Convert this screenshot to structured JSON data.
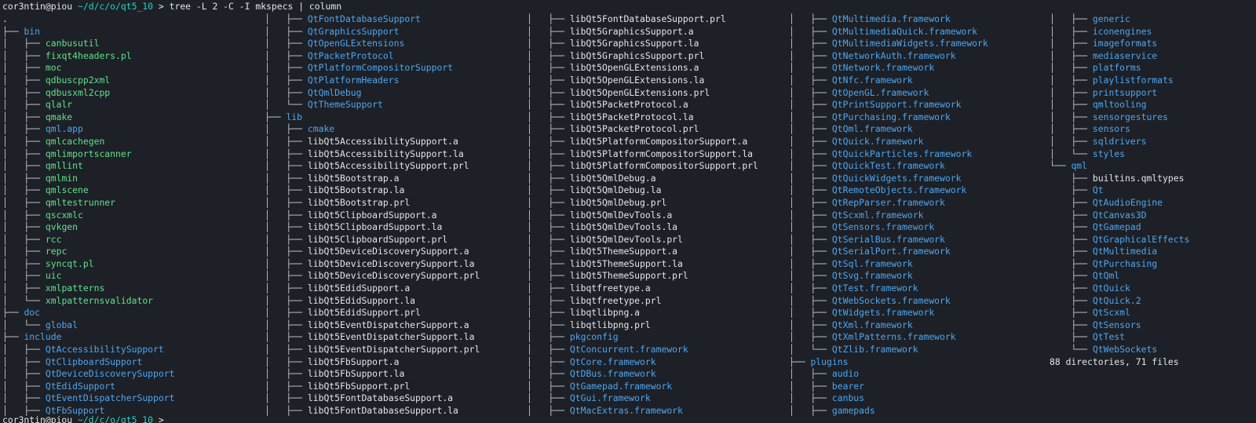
{
  "terminal": {
    "prompt": {
      "user_host": "cor3ntin@piou",
      "path": "~/d/c/o/qt5_10",
      "symbol": ">",
      "command": "tree -L 2 -C -I mkspecs | column"
    },
    "last_prompt": {
      "user_host": "cor3ntin@piou",
      "path": "~/d/c/o/qt5_10",
      "symbol": ">"
    },
    "colors": {
      "background": "#1d2026",
      "text": "#e3e6ea",
      "directory": "#4ea6f0",
      "executable": "#5fe28b",
      "prompt_path": "#23d3c6"
    },
    "columns": [
      [
        {
          "p": "",
          "n": ".",
          "k": "file"
        },
        {
          "p": "├── ",
          "n": "bin",
          "k": "dir"
        },
        {
          "p": "│   ├── ",
          "n": "canbusutil",
          "k": "exec"
        },
        {
          "p": "│   ├── ",
          "n": "fixqt4headers.pl",
          "k": "exec"
        },
        {
          "p": "│   ├── ",
          "n": "moc",
          "k": "exec"
        },
        {
          "p": "│   ├── ",
          "n": "qdbuscpp2xml",
          "k": "exec"
        },
        {
          "p": "│   ├── ",
          "n": "qdbusxml2cpp",
          "k": "exec"
        },
        {
          "p": "│   ├── ",
          "n": "qlalr",
          "k": "exec"
        },
        {
          "p": "│   ├── ",
          "n": "qmake",
          "k": "exec"
        },
        {
          "p": "│   ├── ",
          "n": "qml.app",
          "k": "dir"
        },
        {
          "p": "│   ├── ",
          "n": "qmlcachegen",
          "k": "exec"
        },
        {
          "p": "│   ├── ",
          "n": "qmlimportscanner",
          "k": "exec"
        },
        {
          "p": "│   ├── ",
          "n": "qmllint",
          "k": "exec"
        },
        {
          "p": "│   ├── ",
          "n": "qmlmin",
          "k": "exec"
        },
        {
          "p": "│   ├── ",
          "n": "qmlscene",
          "k": "exec"
        },
        {
          "p": "│   ├── ",
          "n": "qmltestrunner",
          "k": "exec"
        },
        {
          "p": "│   ├── ",
          "n": "qscxmlc",
          "k": "exec"
        },
        {
          "p": "│   ├── ",
          "n": "qvkgen",
          "k": "exec"
        },
        {
          "p": "│   ├── ",
          "n": "rcc",
          "k": "exec"
        },
        {
          "p": "│   ├── ",
          "n": "repc",
          "k": "exec"
        },
        {
          "p": "│   ├── ",
          "n": "syncqt.pl",
          "k": "exec"
        },
        {
          "p": "│   ├── ",
          "n": "uic",
          "k": "exec"
        },
        {
          "p": "│   ├── ",
          "n": "xmlpatterns",
          "k": "exec"
        },
        {
          "p": "│   └── ",
          "n": "xmlpatternsvalidator",
          "k": "exec"
        },
        {
          "p": "├── ",
          "n": "doc",
          "k": "dir"
        },
        {
          "p": "│   └── ",
          "n": "global",
          "k": "dir"
        },
        {
          "p": "├── ",
          "n": "include",
          "k": "dir"
        },
        {
          "p": "│   ├── ",
          "n": "QtAccessibilitySupport",
          "k": "dir"
        },
        {
          "p": "│   ├── ",
          "n": "QtClipboardSupport",
          "k": "dir"
        },
        {
          "p": "│   ├── ",
          "n": "QtDeviceDiscoverySupport",
          "k": "dir"
        },
        {
          "p": "│   ├── ",
          "n": "QtEdidSupport",
          "k": "dir"
        },
        {
          "p": "│   ├── ",
          "n": "QtEventDispatcherSupport",
          "k": "dir"
        },
        {
          "p": "│   ├── ",
          "n": "QtFbSupport",
          "k": "dir"
        }
      ],
      [
        {
          "p": "│   ├── ",
          "n": "QtFontDatabaseSupport",
          "k": "dir"
        },
        {
          "p": "│   ├── ",
          "n": "QtGraphicsSupport",
          "k": "dir"
        },
        {
          "p": "│   ├── ",
          "n": "QtOpenGLExtensions",
          "k": "dir"
        },
        {
          "p": "│   ├── ",
          "n": "QtPacketProtocol",
          "k": "dir"
        },
        {
          "p": "│   ├── ",
          "n": "QtPlatformCompositorSupport",
          "k": "dir"
        },
        {
          "p": "│   ├── ",
          "n": "QtPlatformHeaders",
          "k": "dir"
        },
        {
          "p": "│   ├── ",
          "n": "QtQmlDebug",
          "k": "dir"
        },
        {
          "p": "│   └── ",
          "n": "QtThemeSupport",
          "k": "dir"
        },
        {
          "p": "├── ",
          "n": "lib",
          "k": "dir"
        },
        {
          "p": "│   ├── ",
          "n": "cmake",
          "k": "dir"
        },
        {
          "p": "│   ├── ",
          "n": "libQt5AccessibilitySupport.a",
          "k": "file"
        },
        {
          "p": "│   ├── ",
          "n": "libQt5AccessibilitySupport.la",
          "k": "file"
        },
        {
          "p": "│   ├── ",
          "n": "libQt5AccessibilitySupport.prl",
          "k": "file"
        },
        {
          "p": "│   ├── ",
          "n": "libQt5Bootstrap.a",
          "k": "file"
        },
        {
          "p": "│   ├── ",
          "n": "libQt5Bootstrap.la",
          "k": "file"
        },
        {
          "p": "│   ├── ",
          "n": "libQt5Bootstrap.prl",
          "k": "file"
        },
        {
          "p": "│   ├── ",
          "n": "libQt5ClipboardSupport.a",
          "k": "file"
        },
        {
          "p": "│   ├── ",
          "n": "libQt5ClipboardSupport.la",
          "k": "file"
        },
        {
          "p": "│   ├── ",
          "n": "libQt5ClipboardSupport.prl",
          "k": "file"
        },
        {
          "p": "│   ├── ",
          "n": "libQt5DeviceDiscoverySupport.a",
          "k": "file"
        },
        {
          "p": "│   ├── ",
          "n": "libQt5DeviceDiscoverySupport.la",
          "k": "file"
        },
        {
          "p": "│   ├── ",
          "n": "libQt5DeviceDiscoverySupport.prl",
          "k": "file"
        },
        {
          "p": "│   ├── ",
          "n": "libQt5EdidSupport.a",
          "k": "file"
        },
        {
          "p": "│   ├── ",
          "n": "libQt5EdidSupport.la",
          "k": "file"
        },
        {
          "p": "│   ├── ",
          "n": "libQt5EdidSupport.prl",
          "k": "file"
        },
        {
          "p": "│   ├── ",
          "n": "libQt5EventDispatcherSupport.a",
          "k": "file"
        },
        {
          "p": "│   ├── ",
          "n": "libQt5EventDispatcherSupport.la",
          "k": "file"
        },
        {
          "p": "│   ├── ",
          "n": "libQt5EventDispatcherSupport.prl",
          "k": "file"
        },
        {
          "p": "│   ├── ",
          "n": "libQt5FbSupport.a",
          "k": "file"
        },
        {
          "p": "│   ├── ",
          "n": "libQt5FbSupport.la",
          "k": "file"
        },
        {
          "p": "│   ├── ",
          "n": "libQt5FbSupport.prl",
          "k": "file"
        },
        {
          "p": "│   ├── ",
          "n": "libQt5FontDatabaseSupport.a",
          "k": "file"
        },
        {
          "p": "│   ├── ",
          "n": "libQt5FontDatabaseSupport.la",
          "k": "file"
        }
      ],
      [
        {
          "p": "│   ├── ",
          "n": "libQt5FontDatabaseSupport.prl",
          "k": "file"
        },
        {
          "p": "│   ├── ",
          "n": "libQt5GraphicsSupport.a",
          "k": "file"
        },
        {
          "p": "│   ├── ",
          "n": "libQt5GraphicsSupport.la",
          "k": "file"
        },
        {
          "p": "│   ├── ",
          "n": "libQt5GraphicsSupport.prl",
          "k": "file"
        },
        {
          "p": "│   ├── ",
          "n": "libQt5OpenGLExtensions.a",
          "k": "file"
        },
        {
          "p": "│   ├── ",
          "n": "libQt5OpenGLExtensions.la",
          "k": "file"
        },
        {
          "p": "│   ├── ",
          "n": "libQt5OpenGLExtensions.prl",
          "k": "file"
        },
        {
          "p": "│   ├── ",
          "n": "libQt5PacketProtocol.a",
          "k": "file"
        },
        {
          "p": "│   ├── ",
          "n": "libQt5PacketProtocol.la",
          "k": "file"
        },
        {
          "p": "│   ├── ",
          "n": "libQt5PacketProtocol.prl",
          "k": "file"
        },
        {
          "p": "│   ├── ",
          "n": "libQt5PlatformCompositorSupport.a",
          "k": "file"
        },
        {
          "p": "│   ├── ",
          "n": "libQt5PlatformCompositorSupport.la",
          "k": "file"
        },
        {
          "p": "│   ├── ",
          "n": "libQt5PlatformCompositorSupport.prl",
          "k": "file"
        },
        {
          "p": "│   ├── ",
          "n": "libQt5QmlDebug.a",
          "k": "file"
        },
        {
          "p": "│   ├── ",
          "n": "libQt5QmlDebug.la",
          "k": "file"
        },
        {
          "p": "│   ├── ",
          "n": "libQt5QmlDebug.prl",
          "k": "file"
        },
        {
          "p": "│   ├── ",
          "n": "libQt5QmlDevTools.a",
          "k": "file"
        },
        {
          "p": "│   ├── ",
          "n": "libQt5QmlDevTools.la",
          "k": "file"
        },
        {
          "p": "│   ├── ",
          "n": "libQt5QmlDevTools.prl",
          "k": "file"
        },
        {
          "p": "│   ├── ",
          "n": "libQt5ThemeSupport.a",
          "k": "file"
        },
        {
          "p": "│   ├── ",
          "n": "libQt5ThemeSupport.la",
          "k": "file"
        },
        {
          "p": "│   ├── ",
          "n": "libQt5ThemeSupport.prl",
          "k": "file"
        },
        {
          "p": "│   ├── ",
          "n": "libqtfreetype.a",
          "k": "file"
        },
        {
          "p": "│   ├── ",
          "n": "libqtfreetype.prl",
          "k": "file"
        },
        {
          "p": "│   ├── ",
          "n": "libqtlibpng.a",
          "k": "file"
        },
        {
          "p": "│   ├── ",
          "n": "libqtlibpng.prl",
          "k": "file"
        },
        {
          "p": "│   ├── ",
          "n": "pkgconfig",
          "k": "dir"
        },
        {
          "p": "│   ├── ",
          "n": "QtConcurrent.framework",
          "k": "dir"
        },
        {
          "p": "│   ├── ",
          "n": "QtCore.framework",
          "k": "dir"
        },
        {
          "p": "│   ├── ",
          "n": "QtDBus.framework",
          "k": "dir"
        },
        {
          "p": "│   ├── ",
          "n": "QtGamepad.framework",
          "k": "dir"
        },
        {
          "p": "│   ├── ",
          "n": "QtGui.framework",
          "k": "dir"
        },
        {
          "p": "│   ├── ",
          "n": "QtMacExtras.framework",
          "k": "dir"
        }
      ],
      [
        {
          "p": "│   ├── ",
          "n": "QtMultimedia.framework",
          "k": "dir"
        },
        {
          "p": "│   ├── ",
          "n": "QtMultimediaQuick.framework",
          "k": "dir"
        },
        {
          "p": "│   ├── ",
          "n": "QtMultimediaWidgets.framework",
          "k": "dir"
        },
        {
          "p": "│   ├── ",
          "n": "QtNetworkAuth.framework",
          "k": "dir"
        },
        {
          "p": "│   ├── ",
          "n": "QtNetwork.framework",
          "k": "dir"
        },
        {
          "p": "│   ├── ",
          "n": "QtNfc.framework",
          "k": "dir"
        },
        {
          "p": "│   ├── ",
          "n": "QtOpenGL.framework",
          "k": "dir"
        },
        {
          "p": "│   ├── ",
          "n": "QtPrintSupport.framework",
          "k": "dir"
        },
        {
          "p": "│   ├── ",
          "n": "QtPurchasing.framework",
          "k": "dir"
        },
        {
          "p": "│   ├── ",
          "n": "QtQml.framework",
          "k": "dir"
        },
        {
          "p": "│   ├── ",
          "n": "QtQuick.framework",
          "k": "dir"
        },
        {
          "p": "│   ├── ",
          "n": "QtQuickParticles.framework",
          "k": "dir"
        },
        {
          "p": "│   ├── ",
          "n": "QtQuickTest.framework",
          "k": "dir"
        },
        {
          "p": "│   ├── ",
          "n": "QtQuickWidgets.framework",
          "k": "dir"
        },
        {
          "p": "│   ├── ",
          "n": "QtRemoteObjects.framework",
          "k": "dir"
        },
        {
          "p": "│   ├── ",
          "n": "QtRepParser.framework",
          "k": "dir"
        },
        {
          "p": "│   ├── ",
          "n": "QtScxml.framework",
          "k": "dir"
        },
        {
          "p": "│   ├── ",
          "n": "QtSensors.framework",
          "k": "dir"
        },
        {
          "p": "│   ├── ",
          "n": "QtSerialBus.framework",
          "k": "dir"
        },
        {
          "p": "│   ├── ",
          "n": "QtSerialPort.framework",
          "k": "dir"
        },
        {
          "p": "│   ├── ",
          "n": "QtSql.framework",
          "k": "dir"
        },
        {
          "p": "│   ├── ",
          "n": "QtSvg.framework",
          "k": "dir"
        },
        {
          "p": "│   ├── ",
          "n": "QtTest.framework",
          "k": "dir"
        },
        {
          "p": "│   ├── ",
          "n": "QtWebSockets.framework",
          "k": "dir"
        },
        {
          "p": "│   ├── ",
          "n": "QtWidgets.framework",
          "k": "dir"
        },
        {
          "p": "│   ├── ",
          "n": "QtXml.framework",
          "k": "dir"
        },
        {
          "p": "│   ├── ",
          "n": "QtXmlPatterns.framework",
          "k": "dir"
        },
        {
          "p": "│   └── ",
          "n": "QtZlib.framework",
          "k": "dir"
        },
        {
          "p": "├── ",
          "n": "plugins",
          "k": "dir"
        },
        {
          "p": "│   ├── ",
          "n": "audio",
          "k": "dir"
        },
        {
          "p": "│   ├── ",
          "n": "bearer",
          "k": "dir"
        },
        {
          "p": "│   ├── ",
          "n": "canbus",
          "k": "dir"
        },
        {
          "p": "│   ├── ",
          "n": "gamepads",
          "k": "dir"
        }
      ],
      [
        {
          "p": "│   ├── ",
          "n": "generic",
          "k": "dir"
        },
        {
          "p": "│   ├── ",
          "n": "iconengines",
          "k": "dir"
        },
        {
          "p": "│   ├── ",
          "n": "imageformats",
          "k": "dir"
        },
        {
          "p": "│   ├── ",
          "n": "mediaservice",
          "k": "dir"
        },
        {
          "p": "│   ├── ",
          "n": "platforms",
          "k": "dir"
        },
        {
          "p": "│   ├── ",
          "n": "playlistformats",
          "k": "dir"
        },
        {
          "p": "│   ├── ",
          "n": "printsupport",
          "k": "dir"
        },
        {
          "p": "│   ├── ",
          "n": "qmltooling",
          "k": "dir"
        },
        {
          "p": "│   ├── ",
          "n": "sensorgestures",
          "k": "dir"
        },
        {
          "p": "│   ├── ",
          "n": "sensors",
          "k": "dir"
        },
        {
          "p": "│   ├── ",
          "n": "sqldrivers",
          "k": "dir"
        },
        {
          "p": "│   └── ",
          "n": "styles",
          "k": "dir"
        },
        {
          "p": "└── ",
          "n": "qml",
          "k": "dir"
        },
        {
          "p": "    ├── ",
          "n": "builtins.qmltypes",
          "k": "file"
        },
        {
          "p": "    ├── ",
          "n": "Qt",
          "k": "dir"
        },
        {
          "p": "    ├── ",
          "n": "QtAudioEngine",
          "k": "dir"
        },
        {
          "p": "    ├── ",
          "n": "QtCanvas3D",
          "k": "dir"
        },
        {
          "p": "    ├── ",
          "n": "QtGamepad",
          "k": "dir"
        },
        {
          "p": "    ├── ",
          "n": "QtGraphicalEffects",
          "k": "dir"
        },
        {
          "p": "    ├── ",
          "n": "QtMultimedia",
          "k": "dir"
        },
        {
          "p": "    ├── ",
          "n": "QtPurchasing",
          "k": "dir"
        },
        {
          "p": "    ├── ",
          "n": "QtQml",
          "k": "dir"
        },
        {
          "p": "    ├── ",
          "n": "QtQuick",
          "k": "dir"
        },
        {
          "p": "    ├── ",
          "n": "QtQuick.2",
          "k": "dir"
        },
        {
          "p": "    ├── ",
          "n": "QtScxml",
          "k": "dir"
        },
        {
          "p": "    ├── ",
          "n": "QtSensors",
          "k": "dir"
        },
        {
          "p": "    ├── ",
          "n": "QtTest",
          "k": "dir"
        },
        {
          "p": "    └── ",
          "n": "QtWebSockets",
          "k": "dir"
        },
        {
          "p": "",
          "n": "88 directories, 71 files",
          "k": "summary"
        }
      ]
    ]
  }
}
